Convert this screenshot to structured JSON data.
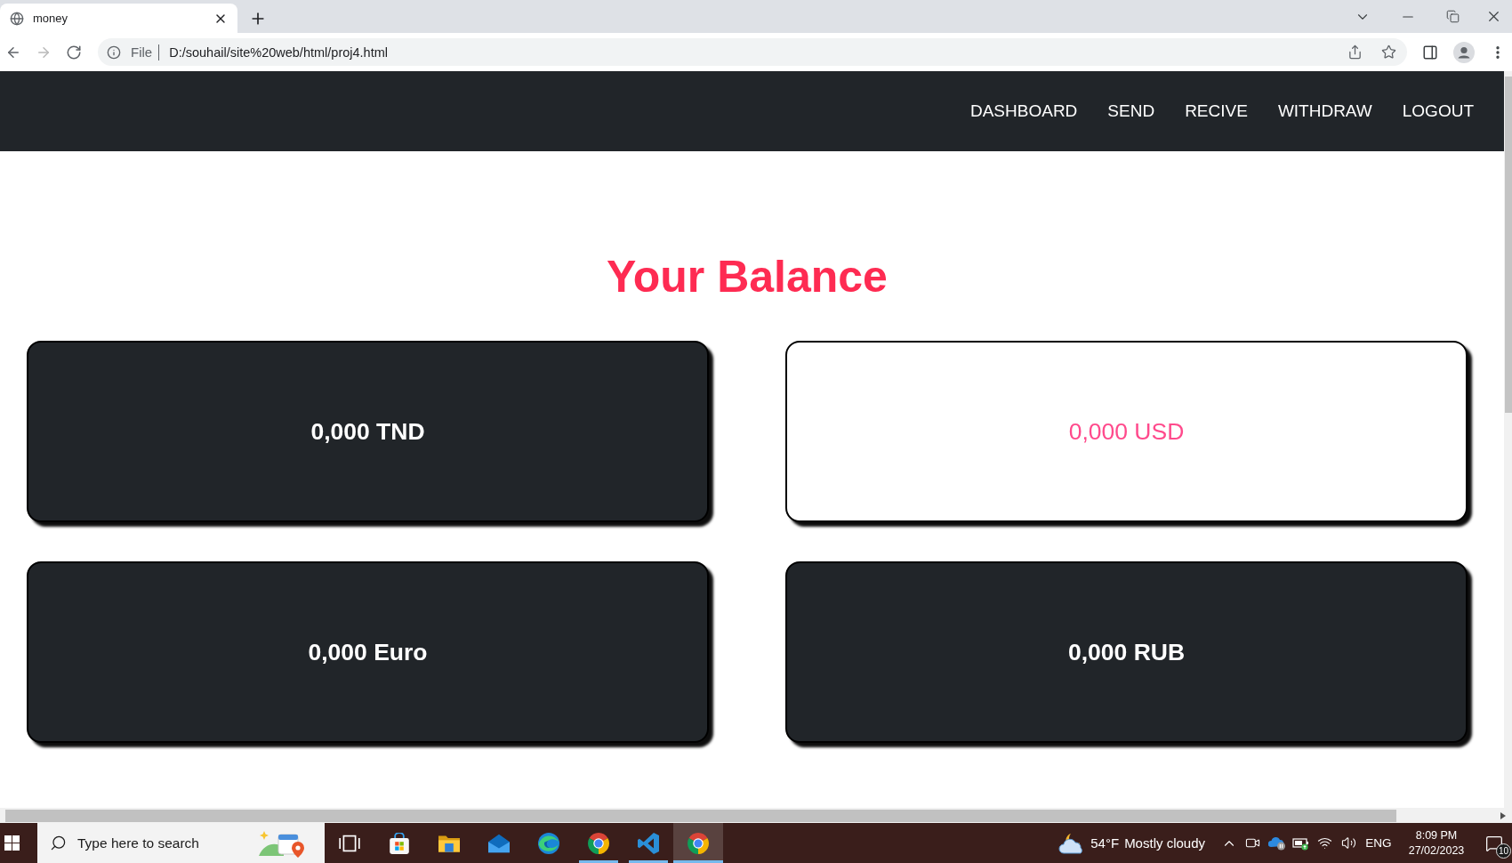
{
  "window": {
    "tabs": [
      {
        "title": "money",
        "selected": true
      }
    ],
    "nav_buttons": [
      {
        "kind": "back",
        "disabled": false
      },
      {
        "kind": "forward",
        "disabled": true
      },
      {
        "kind": "reload",
        "disabled": false
      }
    ],
    "address_bar": {
      "scheme_label": "File",
      "url": "D:/souhail/site%20web/html/proj4.html"
    }
  },
  "navbar": {
    "items": [
      "DASHBOARD",
      "SEND",
      "RECIVE",
      "WITHDRAW",
      "LOGOUT"
    ]
  },
  "page": {
    "title": "Your Balance",
    "balances": [
      {
        "amount": "0,000 TND",
        "selected": false
      },
      {
        "amount": "0,000 USD",
        "selected": true
      },
      {
        "amount": "0,000 Euro",
        "selected": false
      },
      {
        "amount": "0,000 RUB",
        "selected": false
      }
    ]
  },
  "taskbar": {
    "search": {
      "placeholder": "Type here to search"
    },
    "apps": [
      {
        "kind": "task-view",
        "running": false,
        "selected": false
      },
      {
        "kind": "store",
        "running": false,
        "selected": false
      },
      {
        "kind": "folder",
        "running": false,
        "selected": false
      },
      {
        "kind": "mail",
        "running": false,
        "selected": false
      },
      {
        "kind": "edge",
        "running": false,
        "selected": false
      },
      {
        "kind": "chrome",
        "running": true,
        "selected": false
      },
      {
        "kind": "code",
        "running": true,
        "selected": false
      },
      {
        "kind": "chrome",
        "running": true,
        "selected": true
      }
    ],
    "weather": {
      "temperature": "54°F",
      "condition": "Mostly cloudy"
    },
    "language": "ENG",
    "time": "8:09 PM",
    "date": "27/02/2023",
    "notifications": "10"
  }
}
